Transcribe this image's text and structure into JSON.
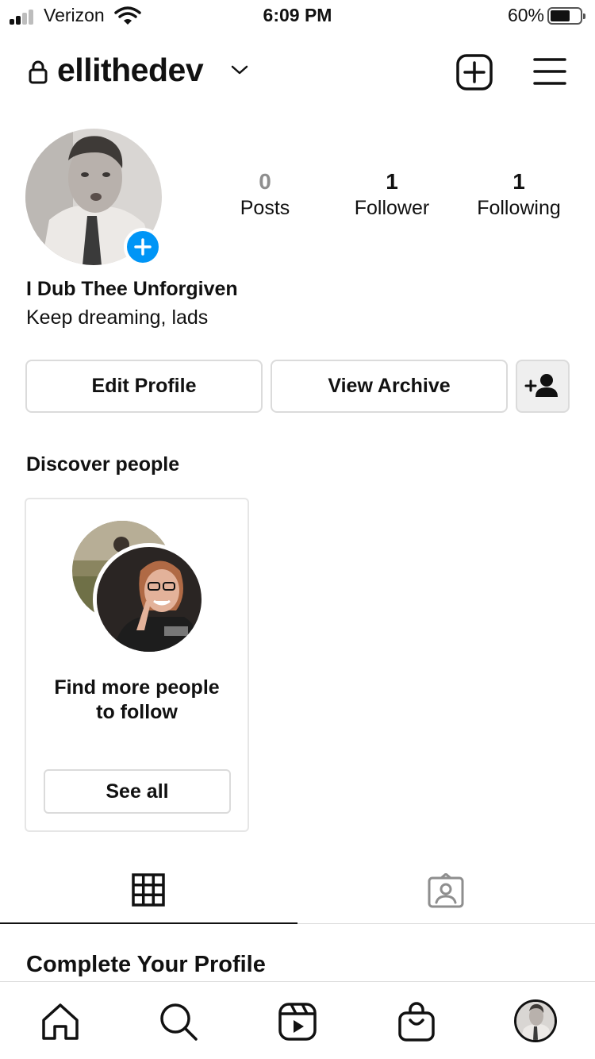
{
  "status_bar": {
    "carrier": "Verizon",
    "time": "6:09 PM",
    "battery_percent": "60%"
  },
  "header": {
    "username": "ellithedev"
  },
  "profile": {
    "stats": [
      {
        "value": "0",
        "label": "Posts"
      },
      {
        "value": "1",
        "label": "Follower"
      },
      {
        "value": "1",
        "label": "Following"
      }
    ],
    "display_name": "I Dub Thee Unforgiven",
    "bio": "Keep dreaming, lads"
  },
  "actions": {
    "edit_profile": "Edit Profile",
    "view_archive": "View Archive"
  },
  "discover": {
    "title": "Discover people",
    "card_text_line1": "Find more people",
    "card_text_line2": "to follow",
    "see_all": "See all"
  },
  "tabs": [
    "grid-icon",
    "tagged-icon"
  ],
  "complete_profile": {
    "title": "Complete Your Profile"
  },
  "bottom_nav": [
    "home-icon",
    "search-icon",
    "reels-icon",
    "shop-icon",
    "profile-avatar"
  ],
  "colors": {
    "accent": "#0095f6",
    "border": "#dbdbdb"
  }
}
